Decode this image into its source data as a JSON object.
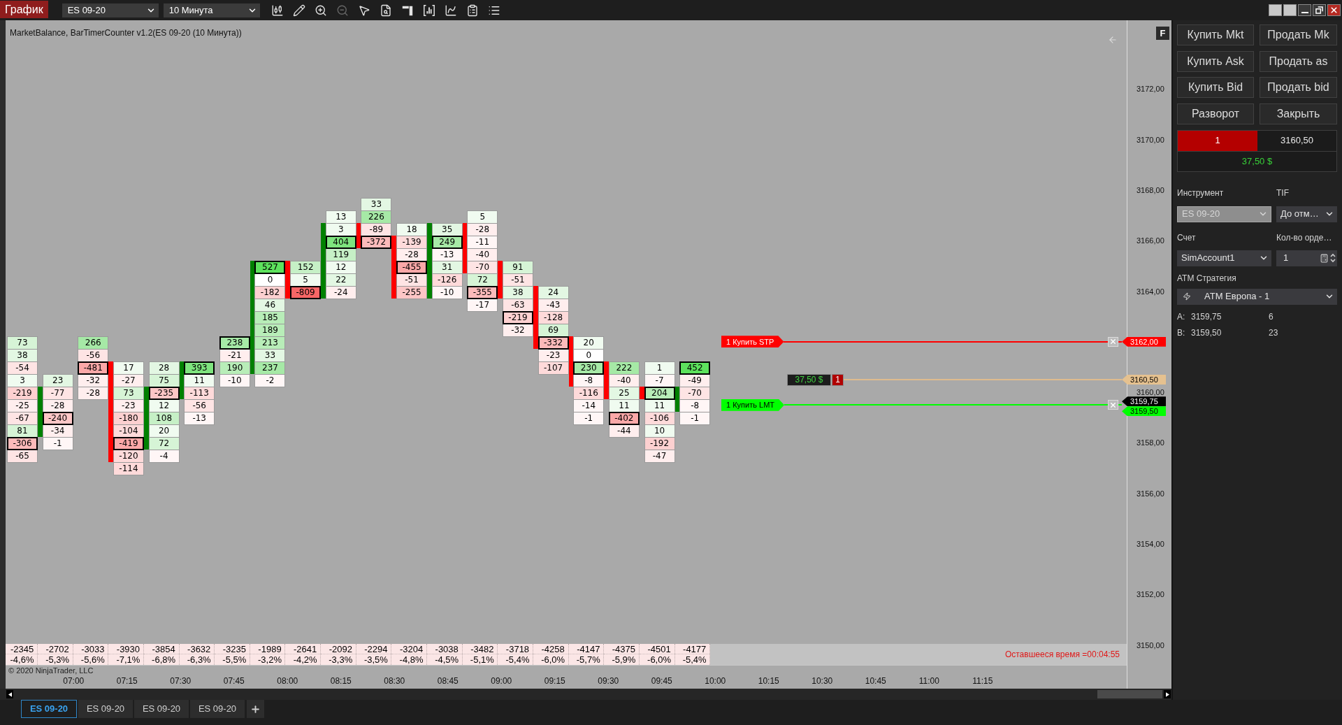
{
  "window": {
    "title": "График",
    "instrument": "ES 09-20",
    "interval": "10 Минута"
  },
  "toolbar": [
    {
      "kind": "candles",
      "disabled": false
    },
    {
      "kind": "pencil",
      "disabled": false
    },
    {
      "kind": "zoomin",
      "disabled": false
    },
    {
      "kind": "zoomout",
      "disabled": true
    },
    {
      "kind": "pointer",
      "disabled": false
    },
    {
      "kind": "document",
      "disabled": false
    },
    {
      "kind": "panel",
      "disabled": false
    },
    {
      "kind": "frame",
      "disabled": false
    },
    {
      "kind": "spline",
      "disabled": false
    },
    {
      "kind": "clipboard",
      "disabled": false
    },
    {
      "kind": "list",
      "disabled": false
    }
  ],
  "chart": {
    "indicator_label": "MarketBalance, BarTimerCounter v1.2(ES 09-20 (10 Минута))",
    "axis_button": "F",
    "copyright": "© 2020 NinjaTrader, LLC",
    "timer": "Оставшееся время =00:04:55"
  },
  "footprint": {
    "columns": [
      {
        "top": [
          {
            "kind": "gap"
          },
          {
            "kind": "gap"
          },
          {
            "kind": "gap"
          },
          {
            "kind": "gap"
          },
          {
            "kind": "gap"
          },
          {
            "kind": "gap"
          },
          {
            "kind": "gap"
          },
          {
            "kind": "gap"
          },
          {
            "kind": "gap"
          },
          {
            "kind": "gap"
          },
          {
            "kind": "gap"
          },
          {
            "kind": "cell",
            "value": "73",
            "color": "#d6f4d6",
            "boxed": false
          },
          {
            "kind": "cell",
            "value": "38",
            "color": "#e3f7e3",
            "boxed": false
          },
          {
            "kind": "cell",
            "value": "-54",
            "color": "#fee4e4",
            "boxed": false
          },
          {
            "kind": "cell",
            "value": "3",
            "color": "#f0fbf0",
            "boxed": false
          },
          {
            "kind": "cell",
            "value": "-219",
            "color": "#fdd0d0",
            "boxed": false
          },
          {
            "kind": "cell",
            "value": "-25",
            "color": "#ffeeee",
            "boxed": false
          },
          {
            "kind": "cell",
            "value": "-67",
            "color": "#fee4e4",
            "boxed": false
          },
          {
            "kind": "cell",
            "value": "81",
            "color": "#d6f4d6",
            "boxed": false
          },
          {
            "kind": "cell",
            "value": "-306",
            "color": "#fcbaba",
            "boxed": true
          },
          {
            "kind": "cell",
            "value": "-65",
            "color": "#fee4e4",
            "boxed": false
          }
        ]
      },
      {
        "color": "#008000",
        "top": [
          {
            "kind": "gap"
          },
          {
            "kind": "gap"
          },
          {
            "kind": "gap"
          },
          {
            "kind": "gap"
          },
          {
            "kind": "gap"
          },
          {
            "kind": "gap"
          },
          {
            "kind": "gap"
          },
          {
            "kind": "gap"
          },
          {
            "kind": "gap"
          },
          {
            "kind": "gap"
          },
          {
            "kind": "gap"
          },
          {
            "kind": "gap"
          },
          {
            "kind": "gap"
          },
          {
            "kind": "gap"
          },
          {
            "kind": "cell",
            "value": "23",
            "color": "#e3f7e3",
            "boxed": false
          }
        ],
        "body": [
          {
            "kind": "cell",
            "value": "-77",
            "color": "#fee4e4",
            "boxed": false
          },
          {
            "kind": "cell",
            "value": "-28",
            "color": "#ffeeee",
            "boxed": false
          },
          {
            "kind": "cell",
            "value": "-240",
            "color": "#fdc6c6",
            "boxed": true
          },
          {
            "kind": "cell",
            "value": "-34",
            "color": "#ffeeee",
            "boxed": false
          }
        ],
        "bottom": [
          {
            "kind": "cell",
            "value": "-1",
            "color": "#fff6f6",
            "boxed": false
          }
        ]
      },
      {
        "top": [
          {
            "kind": "gap"
          },
          {
            "kind": "gap"
          },
          {
            "kind": "gap"
          },
          {
            "kind": "gap"
          },
          {
            "kind": "gap"
          },
          {
            "kind": "gap"
          },
          {
            "kind": "gap"
          },
          {
            "kind": "gap"
          },
          {
            "kind": "gap"
          },
          {
            "kind": "gap"
          },
          {
            "kind": "gap"
          },
          {
            "kind": "cell",
            "value": "266",
            "color": "#a6e9a6",
            "boxed": false
          },
          {
            "kind": "cell",
            "value": "-56",
            "color": "#fee4e4",
            "boxed": false
          },
          {
            "kind": "cell",
            "value": "-481",
            "color": "#fba8a8",
            "boxed": true
          },
          {
            "kind": "cell",
            "value": "-32",
            "color": "#ffeeee",
            "boxed": false
          },
          {
            "kind": "cell",
            "value": "-28",
            "color": "#ffeeee",
            "boxed": false
          }
        ]
      },
      {
        "color": "#ff0000",
        "top": [
          {
            "kind": "gap"
          },
          {
            "kind": "gap"
          },
          {
            "kind": "gap"
          },
          {
            "kind": "gap"
          },
          {
            "kind": "gap"
          },
          {
            "kind": "gap"
          },
          {
            "kind": "gap"
          },
          {
            "kind": "gap"
          },
          {
            "kind": "gap"
          },
          {
            "kind": "gap"
          },
          {
            "kind": "gap"
          },
          {
            "kind": "gap"
          },
          {
            "kind": "gap"
          }
        ],
        "body": [
          {
            "kind": "cell",
            "value": "17",
            "color": "#f0fbf0",
            "boxed": false
          },
          {
            "kind": "cell",
            "value": "-27",
            "color": "#ffeeee",
            "boxed": false
          },
          {
            "kind": "cell",
            "value": "73",
            "color": "#d6f4d6",
            "boxed": false
          },
          {
            "kind": "cell",
            "value": "-23",
            "color": "#ffeeee",
            "boxed": false
          },
          {
            "kind": "cell",
            "value": "-180",
            "color": "#fdd0d0",
            "boxed": false
          },
          {
            "kind": "cell",
            "value": "-104",
            "color": "#fedada",
            "boxed": false
          },
          {
            "kind": "cell",
            "value": "-419",
            "color": "#fba8a8",
            "boxed": true
          },
          {
            "kind": "cell",
            "value": "-120",
            "color": "#fedada",
            "boxed": false
          }
        ],
        "bottom": [
          {
            "kind": "cell",
            "value": "-114",
            "color": "#fedada",
            "boxed": false
          }
        ]
      },
      {
        "color": "#008000",
        "top": [
          {
            "kind": "gap"
          },
          {
            "kind": "gap"
          },
          {
            "kind": "gap"
          },
          {
            "kind": "gap"
          },
          {
            "kind": "gap"
          },
          {
            "kind": "gap"
          },
          {
            "kind": "gap"
          },
          {
            "kind": "gap"
          },
          {
            "kind": "gap"
          },
          {
            "kind": "gap"
          },
          {
            "kind": "gap"
          },
          {
            "kind": "gap"
          },
          {
            "kind": "gap"
          },
          {
            "kind": "cell",
            "value": "28",
            "color": "#e3f7e3",
            "boxed": false
          },
          {
            "kind": "cell",
            "value": "75",
            "color": "#d6f4d6",
            "boxed": false
          }
        ],
        "body": [
          {
            "kind": "cell",
            "value": "-235",
            "color": "#fdc6c6",
            "boxed": true
          },
          {
            "kind": "cell",
            "value": "12",
            "color": "#f0fbf0",
            "boxed": false
          },
          {
            "kind": "cell",
            "value": "108",
            "color": "#c6f0c6",
            "boxed": false
          },
          {
            "kind": "cell",
            "value": "20",
            "color": "#f0fbf0",
            "boxed": false
          },
          {
            "kind": "cell",
            "value": "72",
            "color": "#d6f4d6",
            "boxed": false
          }
        ],
        "bottom": [
          {
            "kind": "cell",
            "value": "-4",
            "color": "#fff6f6",
            "boxed": false
          }
        ]
      },
      {
        "color": "#008000",
        "top": [
          {
            "kind": "gap"
          },
          {
            "kind": "gap"
          },
          {
            "kind": "gap"
          },
          {
            "kind": "gap"
          },
          {
            "kind": "gap"
          },
          {
            "kind": "gap"
          },
          {
            "kind": "gap"
          },
          {
            "kind": "gap"
          },
          {
            "kind": "gap"
          },
          {
            "kind": "gap"
          },
          {
            "kind": "gap"
          },
          {
            "kind": "gap"
          },
          {
            "kind": "gap"
          }
        ],
        "body": [
          {
            "kind": "cell",
            "value": "393",
            "color": "#7ee47e",
            "boxed": true
          },
          {
            "kind": "cell",
            "value": "11",
            "color": "#f0fbf0",
            "boxed": false
          },
          {
            "kind": "cell",
            "value": "-113",
            "color": "#fedada",
            "boxed": false
          }
        ],
        "bottom": [
          {
            "kind": "cell",
            "value": "-56",
            "color": "#fee4e4",
            "boxed": false
          },
          {
            "kind": "cell",
            "value": "-13",
            "color": "#fff6f6",
            "boxed": false
          }
        ]
      },
      {
        "top": [
          {
            "kind": "gap"
          },
          {
            "kind": "gap"
          },
          {
            "kind": "gap"
          },
          {
            "kind": "gap"
          },
          {
            "kind": "gap"
          },
          {
            "kind": "gap"
          },
          {
            "kind": "gap"
          },
          {
            "kind": "gap"
          },
          {
            "kind": "gap"
          },
          {
            "kind": "gap"
          },
          {
            "kind": "gap"
          },
          {
            "kind": "cell",
            "value": "238",
            "color": "#a6e9a6",
            "boxed": true
          },
          {
            "kind": "cell",
            "value": "-21",
            "color": "#ffeeee",
            "boxed": false
          },
          {
            "kind": "cell",
            "value": "190",
            "color": "#b8edb8",
            "boxed": false
          },
          {
            "kind": "cell",
            "value": "-10",
            "color": "#fff6f6",
            "boxed": false
          }
        ]
      },
      {
        "color": "#008000",
        "top": [
          {
            "kind": "gap"
          },
          {
            "kind": "gap"
          },
          {
            "kind": "gap"
          },
          {
            "kind": "gap"
          },
          {
            "kind": "gap"
          }
        ],
        "body": [
          {
            "kind": "cell",
            "value": "527",
            "color": "#5de25d",
            "boxed": true
          },
          {
            "kind": "cell",
            "value": "0",
            "color": "#ffffff",
            "boxed": false
          },
          {
            "kind": "cell",
            "value": "-182",
            "color": "#fdd0d0",
            "boxed": false
          },
          {
            "kind": "cell",
            "value": "46",
            "color": "#e3f7e3",
            "boxed": false
          },
          {
            "kind": "cell",
            "value": "185",
            "color": "#b8edb8",
            "boxed": false
          },
          {
            "kind": "cell",
            "value": "189",
            "color": "#b8edb8",
            "boxed": false
          },
          {
            "kind": "cell",
            "value": "213",
            "color": "#b8edb8",
            "boxed": false
          },
          {
            "kind": "cell",
            "value": "33",
            "color": "#e3f7e3",
            "boxed": false
          },
          {
            "kind": "cell",
            "value": "237",
            "color": "#a6e9a6",
            "boxed": false
          }
        ],
        "bottom": [
          {
            "kind": "cell",
            "value": "-2",
            "color": "#fff6f6",
            "boxed": false
          }
        ]
      },
      {
        "color": "#ff0000",
        "top": [
          {
            "kind": "gap"
          },
          {
            "kind": "gap"
          },
          {
            "kind": "gap"
          },
          {
            "kind": "gap"
          },
          {
            "kind": "gap"
          }
        ],
        "body": [
          {
            "kind": "cell",
            "value": "152",
            "color": "#c6f0c6",
            "boxed": false
          },
          {
            "kind": "cell",
            "value": "5",
            "color": "#f0fbf0",
            "boxed": false
          },
          {
            "kind": "cell",
            "value": "-809",
            "color": "#f76666",
            "boxed": true
          }
        ]
      },
      {
        "color": "#008000",
        "top": [
          {
            "kind": "gap"
          },
          {
            "kind": "cell",
            "value": "13",
            "color": "#f0fbf0",
            "boxed": false
          }
        ],
        "body": [
          {
            "kind": "cell",
            "value": "3",
            "color": "#f0fbf0",
            "boxed": false
          },
          {
            "kind": "cell",
            "value": "404",
            "color": "#7ee47e",
            "boxed": true
          },
          {
            "kind": "cell",
            "value": "119",
            "color": "#c6f0c6",
            "boxed": false
          },
          {
            "kind": "cell",
            "value": "12",
            "color": "#f0fbf0",
            "boxed": false
          },
          {
            "kind": "cell",
            "value": "22",
            "color": "#e3f7e3",
            "boxed": false
          },
          {
            "kind": "cell",
            "value": "-24",
            "color": "#ffeeee",
            "boxed": false
          }
        ]
      },
      {
        "color": "#ff0000",
        "top": [
          {
            "kind": "cell",
            "value": "33",
            "color": "#e3f7e3",
            "boxed": false
          },
          {
            "kind": "cell",
            "value": "226",
            "color": "#a6e9a6",
            "boxed": false
          }
        ],
        "body": [
          {
            "kind": "cell",
            "value": "-89",
            "color": "#fee4e4",
            "boxed": false
          },
          {
            "kind": "cell",
            "value": "-372",
            "color": "#fcbaba",
            "boxed": true
          }
        ]
      },
      {
        "color": "#ff0000",
        "top": [
          {
            "kind": "gap"
          },
          {
            "kind": "gap"
          },
          {
            "kind": "cell",
            "value": "18",
            "color": "#f0fbf0",
            "boxed": false
          }
        ],
        "body": [
          {
            "kind": "cell",
            "value": "-139",
            "color": "#fedada",
            "boxed": false
          },
          {
            "kind": "cell",
            "value": "-28",
            "color": "#ffeeee",
            "boxed": false
          },
          {
            "kind": "cell",
            "value": "-455",
            "color": "#fba8a8",
            "boxed": true
          },
          {
            "kind": "cell",
            "value": "-51",
            "color": "#fee4e4",
            "boxed": false
          },
          {
            "kind": "cell",
            "value": "-255",
            "color": "#fdc6c6",
            "boxed": false
          }
        ]
      },
      {
        "color": "#008000",
        "top": [
          {
            "kind": "gap"
          },
          {
            "kind": "gap"
          }
        ],
        "body": [
          {
            "kind": "cell",
            "value": "35",
            "color": "#e3f7e3",
            "boxed": false
          },
          {
            "kind": "cell",
            "value": "249",
            "color": "#a6e9a6",
            "boxed": true
          },
          {
            "kind": "cell",
            "value": "-13",
            "color": "#fff6f6",
            "boxed": false
          },
          {
            "kind": "cell",
            "value": "31",
            "color": "#e3f7e3",
            "boxed": false
          },
          {
            "kind": "cell",
            "value": "-126",
            "color": "#fedada",
            "boxed": false
          },
          {
            "kind": "cell",
            "value": "-10",
            "color": "#fff6f6",
            "boxed": false
          }
        ]
      },
      {
        "color": "#ff0000",
        "top": [
          {
            "kind": "gap"
          },
          {
            "kind": "cell",
            "value": "5",
            "color": "#f0fbf0",
            "boxed": false
          }
        ],
        "body": [
          {
            "kind": "cell",
            "value": "-28",
            "color": "#ffeeee",
            "boxed": false
          },
          {
            "kind": "cell",
            "value": "-11",
            "color": "#fff6f6",
            "boxed": false
          },
          {
            "kind": "cell",
            "value": "-40",
            "color": "#ffeeee",
            "boxed": false
          },
          {
            "kind": "cell",
            "value": "-70",
            "color": "#fee4e4",
            "boxed": false
          }
        ],
        "bottom": [
          {
            "kind": "cell",
            "value": "72",
            "color": "#d6f4d6",
            "boxed": false
          },
          {
            "kind": "cell",
            "value": "-355",
            "color": "#fcbaba",
            "boxed": true
          },
          {
            "kind": "cell",
            "value": "-17",
            "color": "#fff6f6",
            "boxed": false
          }
        ]
      },
      {
        "color": "#ff0000",
        "top": [
          {
            "kind": "gap"
          },
          {
            "kind": "gap"
          },
          {
            "kind": "gap"
          },
          {
            "kind": "gap"
          },
          {
            "kind": "gap"
          }
        ],
        "body": [
          {
            "kind": "cell",
            "value": "91",
            "color": "#d6f4d6",
            "boxed": false
          },
          {
            "kind": "cell",
            "value": "-51",
            "color": "#fee4e4",
            "boxed": false
          },
          {
            "kind": "cell",
            "value": "38",
            "color": "#e3f7e3",
            "boxed": false
          }
        ],
        "bottom": [
          {
            "kind": "cell",
            "value": "-63",
            "color": "#fee4e4",
            "boxed": false
          },
          {
            "kind": "cell",
            "value": "-219",
            "color": "#fdd0d0",
            "boxed": true
          },
          {
            "kind": "cell",
            "value": "-32",
            "color": "#ffeeee",
            "boxed": false
          }
        ]
      },
      {
        "color": "#ff0000",
        "top": [
          {
            "kind": "gap"
          },
          {
            "kind": "gap"
          },
          {
            "kind": "gap"
          },
          {
            "kind": "gap"
          },
          {
            "kind": "gap"
          },
          {
            "kind": "gap"
          },
          {
            "kind": "gap"
          }
        ],
        "body": [
          {
            "kind": "cell",
            "value": "24",
            "color": "#e3f7e3",
            "boxed": false
          },
          {
            "kind": "cell",
            "value": "-43",
            "color": "#ffeeee",
            "boxed": false
          },
          {
            "kind": "cell",
            "value": "-128",
            "color": "#fedada",
            "boxed": false
          },
          {
            "kind": "cell",
            "value": "69",
            "color": "#d6f4d6",
            "boxed": false
          },
          {
            "kind": "cell",
            "value": "-332",
            "color": "#fcbaba",
            "boxed": true
          }
        ],
        "bottom": [
          {
            "kind": "cell",
            "value": "-23",
            "color": "#ffeeee",
            "boxed": false
          },
          {
            "kind": "cell",
            "value": "-107",
            "color": "#fedada",
            "boxed": false
          }
        ]
      },
      {
        "color": "#ff0000",
        "top": [
          {
            "kind": "gap"
          },
          {
            "kind": "gap"
          },
          {
            "kind": "gap"
          },
          {
            "kind": "gap"
          },
          {
            "kind": "gap"
          },
          {
            "kind": "gap"
          },
          {
            "kind": "gap"
          },
          {
            "kind": "gap"
          },
          {
            "kind": "gap"
          },
          {
            "kind": "gap"
          },
          {
            "kind": "gap"
          }
        ],
        "body": [
          {
            "kind": "cell",
            "value": "20",
            "color": "#f0fbf0",
            "boxed": false
          },
          {
            "kind": "cell",
            "value": "0",
            "color": "#ffffff",
            "boxed": false
          },
          {
            "kind": "cell",
            "value": "230",
            "color": "#a6e9a6",
            "boxed": true
          },
          {
            "kind": "cell",
            "value": "-8",
            "color": "#fff6f6",
            "boxed": false
          }
        ],
        "bottom": [
          {
            "kind": "cell",
            "value": "-116",
            "color": "#fedada",
            "boxed": false
          },
          {
            "kind": "cell",
            "value": "-14",
            "color": "#fff6f6",
            "boxed": false
          },
          {
            "kind": "cell",
            "value": "-1",
            "color": "#fff6f6",
            "boxed": false
          }
        ]
      },
      {
        "color": "#ff0000",
        "top": [
          {
            "kind": "gap"
          },
          {
            "kind": "gap"
          },
          {
            "kind": "gap"
          },
          {
            "kind": "gap"
          },
          {
            "kind": "gap"
          },
          {
            "kind": "gap"
          },
          {
            "kind": "gap"
          },
          {
            "kind": "gap"
          },
          {
            "kind": "gap"
          },
          {
            "kind": "gap"
          },
          {
            "kind": "gap"
          },
          {
            "kind": "gap"
          },
          {
            "kind": "gap"
          }
        ],
        "body": [
          {
            "kind": "cell",
            "value": "222",
            "color": "#a6e9a6",
            "boxed": false
          },
          {
            "kind": "cell",
            "value": "-40",
            "color": "#ffeeee",
            "boxed": false
          },
          {
            "kind": "cell",
            "value": "25",
            "color": "#e3f7e3",
            "boxed": false
          }
        ],
        "bottom": [
          {
            "kind": "cell",
            "value": "11",
            "color": "#f0fbf0",
            "boxed": false
          },
          {
            "kind": "cell",
            "value": "-402",
            "color": "#fba8a8",
            "boxed": true
          },
          {
            "kind": "cell",
            "value": "-44",
            "color": "#ffeeee",
            "boxed": false
          }
        ]
      },
      {
        "color": "#ff0000",
        "top": [
          {
            "kind": "gap"
          },
          {
            "kind": "gap"
          },
          {
            "kind": "gap"
          },
          {
            "kind": "gap"
          },
          {
            "kind": "gap"
          },
          {
            "kind": "gap"
          },
          {
            "kind": "gap"
          },
          {
            "kind": "gap"
          },
          {
            "kind": "gap"
          },
          {
            "kind": "gap"
          },
          {
            "kind": "gap"
          },
          {
            "kind": "gap"
          },
          {
            "kind": "gap"
          },
          {
            "kind": "cell",
            "value": "1",
            "color": "#f0fbf0",
            "boxed": false
          },
          {
            "kind": "cell",
            "value": "-7",
            "color": "#fff6f6",
            "boxed": false
          }
        ],
        "body": [
          {
            "kind": "cell",
            "value": "204",
            "color": "#b8edb8",
            "boxed": true
          }
        ],
        "bottom": [
          {
            "kind": "cell",
            "value": "11",
            "color": "#f0fbf0",
            "boxed": false
          },
          {
            "kind": "cell",
            "value": "-106",
            "color": "#fedada",
            "boxed": false
          },
          {
            "kind": "cell",
            "value": "10",
            "color": "#f0fbf0",
            "boxed": false
          },
          {
            "kind": "cell",
            "value": "-192",
            "color": "#fdd0d0",
            "boxed": false
          },
          {
            "kind": "cell",
            "value": "-47",
            "color": "#ffeeee",
            "boxed": false
          }
        ]
      },
      {
        "color": "#008000",
        "top": [
          {
            "kind": "gap"
          },
          {
            "kind": "gap"
          },
          {
            "kind": "gap"
          },
          {
            "kind": "gap"
          },
          {
            "kind": "gap"
          },
          {
            "kind": "gap"
          },
          {
            "kind": "gap"
          },
          {
            "kind": "gap"
          },
          {
            "kind": "gap"
          },
          {
            "kind": "gap"
          },
          {
            "kind": "gap"
          },
          {
            "kind": "gap"
          },
          {
            "kind": "gap"
          },
          {
            "kind": "cell",
            "value": "452",
            "color": "#5de25d",
            "boxed": true
          },
          {
            "kind": "cell",
            "value": "-49",
            "color": "#ffeeee",
            "boxed": false
          }
        ],
        "body": [
          {
            "kind": "cell",
            "value": "-70",
            "color": "#fee4e4",
            "boxed": false
          },
          {
            "kind": "cell",
            "value": "-8",
            "color": "#fff6f6",
            "boxed": false
          }
        ],
        "bottom": [
          {
            "kind": "cell",
            "value": "-1",
            "color": "#fff6f6",
            "boxed": false
          }
        ]
      }
    ]
  },
  "summary": [
    {
      "delta": "-2345",
      "percent": "-4,6%"
    },
    {
      "delta": "-2702",
      "percent": "-5,3%"
    },
    {
      "delta": "-3033",
      "percent": "-5,6%"
    },
    {
      "delta": "-3930",
      "percent": "-7,1%"
    },
    {
      "delta": "-3854",
      "percent": "-6,8%"
    },
    {
      "delta": "-3632",
      "percent": "-6,3%"
    },
    {
      "delta": "-3235",
      "percent": "-5,5%"
    },
    {
      "delta": "-1989",
      "percent": "-3,2%"
    },
    {
      "delta": "-2641",
      "percent": "-4,2%"
    },
    {
      "delta": "-2092",
      "percent": "-3,3%"
    },
    {
      "delta": "-2294",
      "percent": "-3,5%"
    },
    {
      "delta": "-3204",
      "percent": "-4,8%"
    },
    {
      "delta": "-3038",
      "percent": "-4,5%"
    },
    {
      "delta": "-3482",
      "percent": "-5,1%"
    },
    {
      "delta": "-3718",
      "percent": "-5,4%"
    },
    {
      "delta": "-4258",
      "percent": "-6,0%"
    },
    {
      "delta": "-4147",
      "percent": "-5,7%"
    },
    {
      "delta": "-4375",
      "percent": "-5,9%"
    },
    {
      "delta": "-4501",
      "percent": "-6,0%"
    },
    {
      "delta": "-4177",
      "percent": "-5,4%"
    }
  ],
  "time_axis": [
    "07:00",
    "07:15",
    "07:30",
    "07:45",
    "08:00",
    "08:15",
    "08:30",
    "08:45",
    "09:00",
    "09:15",
    "09:30",
    "09:45",
    "10:00",
    "10:15",
    "10:30",
    "10:45",
    "11:00",
    "11:15"
  ],
  "price_axis": [
    "3172,00",
    "3170,00",
    "3168,00",
    "3166,00",
    "3164,00",
    "3160,00",
    "3158,00",
    "3156,00",
    "3154,00",
    "3152,00",
    "3150,00"
  ],
  "orders": [
    {
      "kind": "stop",
      "label": "1 Купить STP",
      "price": "3162,00"
    },
    {
      "kind": "position",
      "pnl": "37,50 $",
      "quantity": "1",
      "color": "#b00000",
      "price": "3160,50"
    },
    {
      "kind": "limit",
      "label": "1 Купить LMT",
      "price": "3159,50"
    }
  ],
  "last_price": "3159,75",
  "order_panel": {
    "buttons": [
      "Купить Mkt",
      "Продать Mk",
      "Купить Ask",
      "Продать as",
      "Купить Bid",
      "Продать bid",
      "Разворот",
      "Закрыть"
    ],
    "position": {
      "color": "#b40000",
      "quantity": "1",
      "price": "3160,50",
      "pnl": "37,50 $"
    },
    "fields": [
      {
        "kind": "dropdown",
        "label": "Инструмент",
        "value": "ES 09-20",
        "disabled": true
      },
      {
        "kind": "dropdown",
        "label": "TIF",
        "value": "До отм…",
        "disabled": false
      },
      {
        "kind": "dropdown",
        "label": "Счет",
        "value": "SimAccount1",
        "disabled": false
      },
      {
        "kind": "number",
        "label": "Кол-во орде…",
        "value": "1",
        "disabled": false
      }
    ],
    "atm": {
      "label": "ATM Стратегия",
      "value": "ATM Европа - 1"
    },
    "quotes": [
      {
        "label": "A:",
        "price": "3159,75",
        "size": "6"
      },
      {
        "label": "B:",
        "price": "3159,50",
        "size": "23"
      }
    ]
  },
  "tabs": [
    {
      "label": "ES 09-20",
      "selected": true
    },
    {
      "label": "ES 09-20",
      "selected": false
    },
    {
      "label": "ES 09-20",
      "selected": false
    },
    {
      "label": "ES 09-20",
      "selected": false
    }
  ]
}
